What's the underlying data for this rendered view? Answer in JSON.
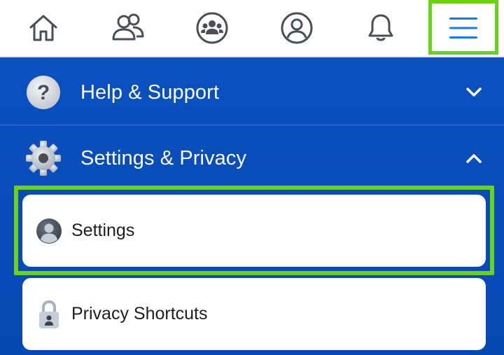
{
  "nav": {
    "items": [
      {
        "icon": "home-icon"
      },
      {
        "icon": "friends-icon"
      },
      {
        "icon": "groups-icon"
      },
      {
        "icon": "profile-icon"
      },
      {
        "icon": "notifications-icon"
      },
      {
        "icon": "menu-icon"
      }
    ],
    "active_color": "#1877f2",
    "highlight_color": "#6bd21b"
  },
  "menu": {
    "help_support": {
      "label": "Help & Support",
      "icon": "question-icon",
      "chevron": "chevron-down-icon"
    },
    "settings_privacy": {
      "label": "Settings & Privacy",
      "icon": "gear-icon",
      "chevron": "chevron-up-icon"
    },
    "subitems": [
      {
        "label": "Settings",
        "icon": "account-icon"
      },
      {
        "label": "Privacy Shortcuts",
        "icon": "lock-icon"
      }
    ]
  },
  "colors": {
    "panel_blue": "#0a4cb6",
    "white": "#ffffff",
    "highlight_green": "#6bd21b"
  }
}
